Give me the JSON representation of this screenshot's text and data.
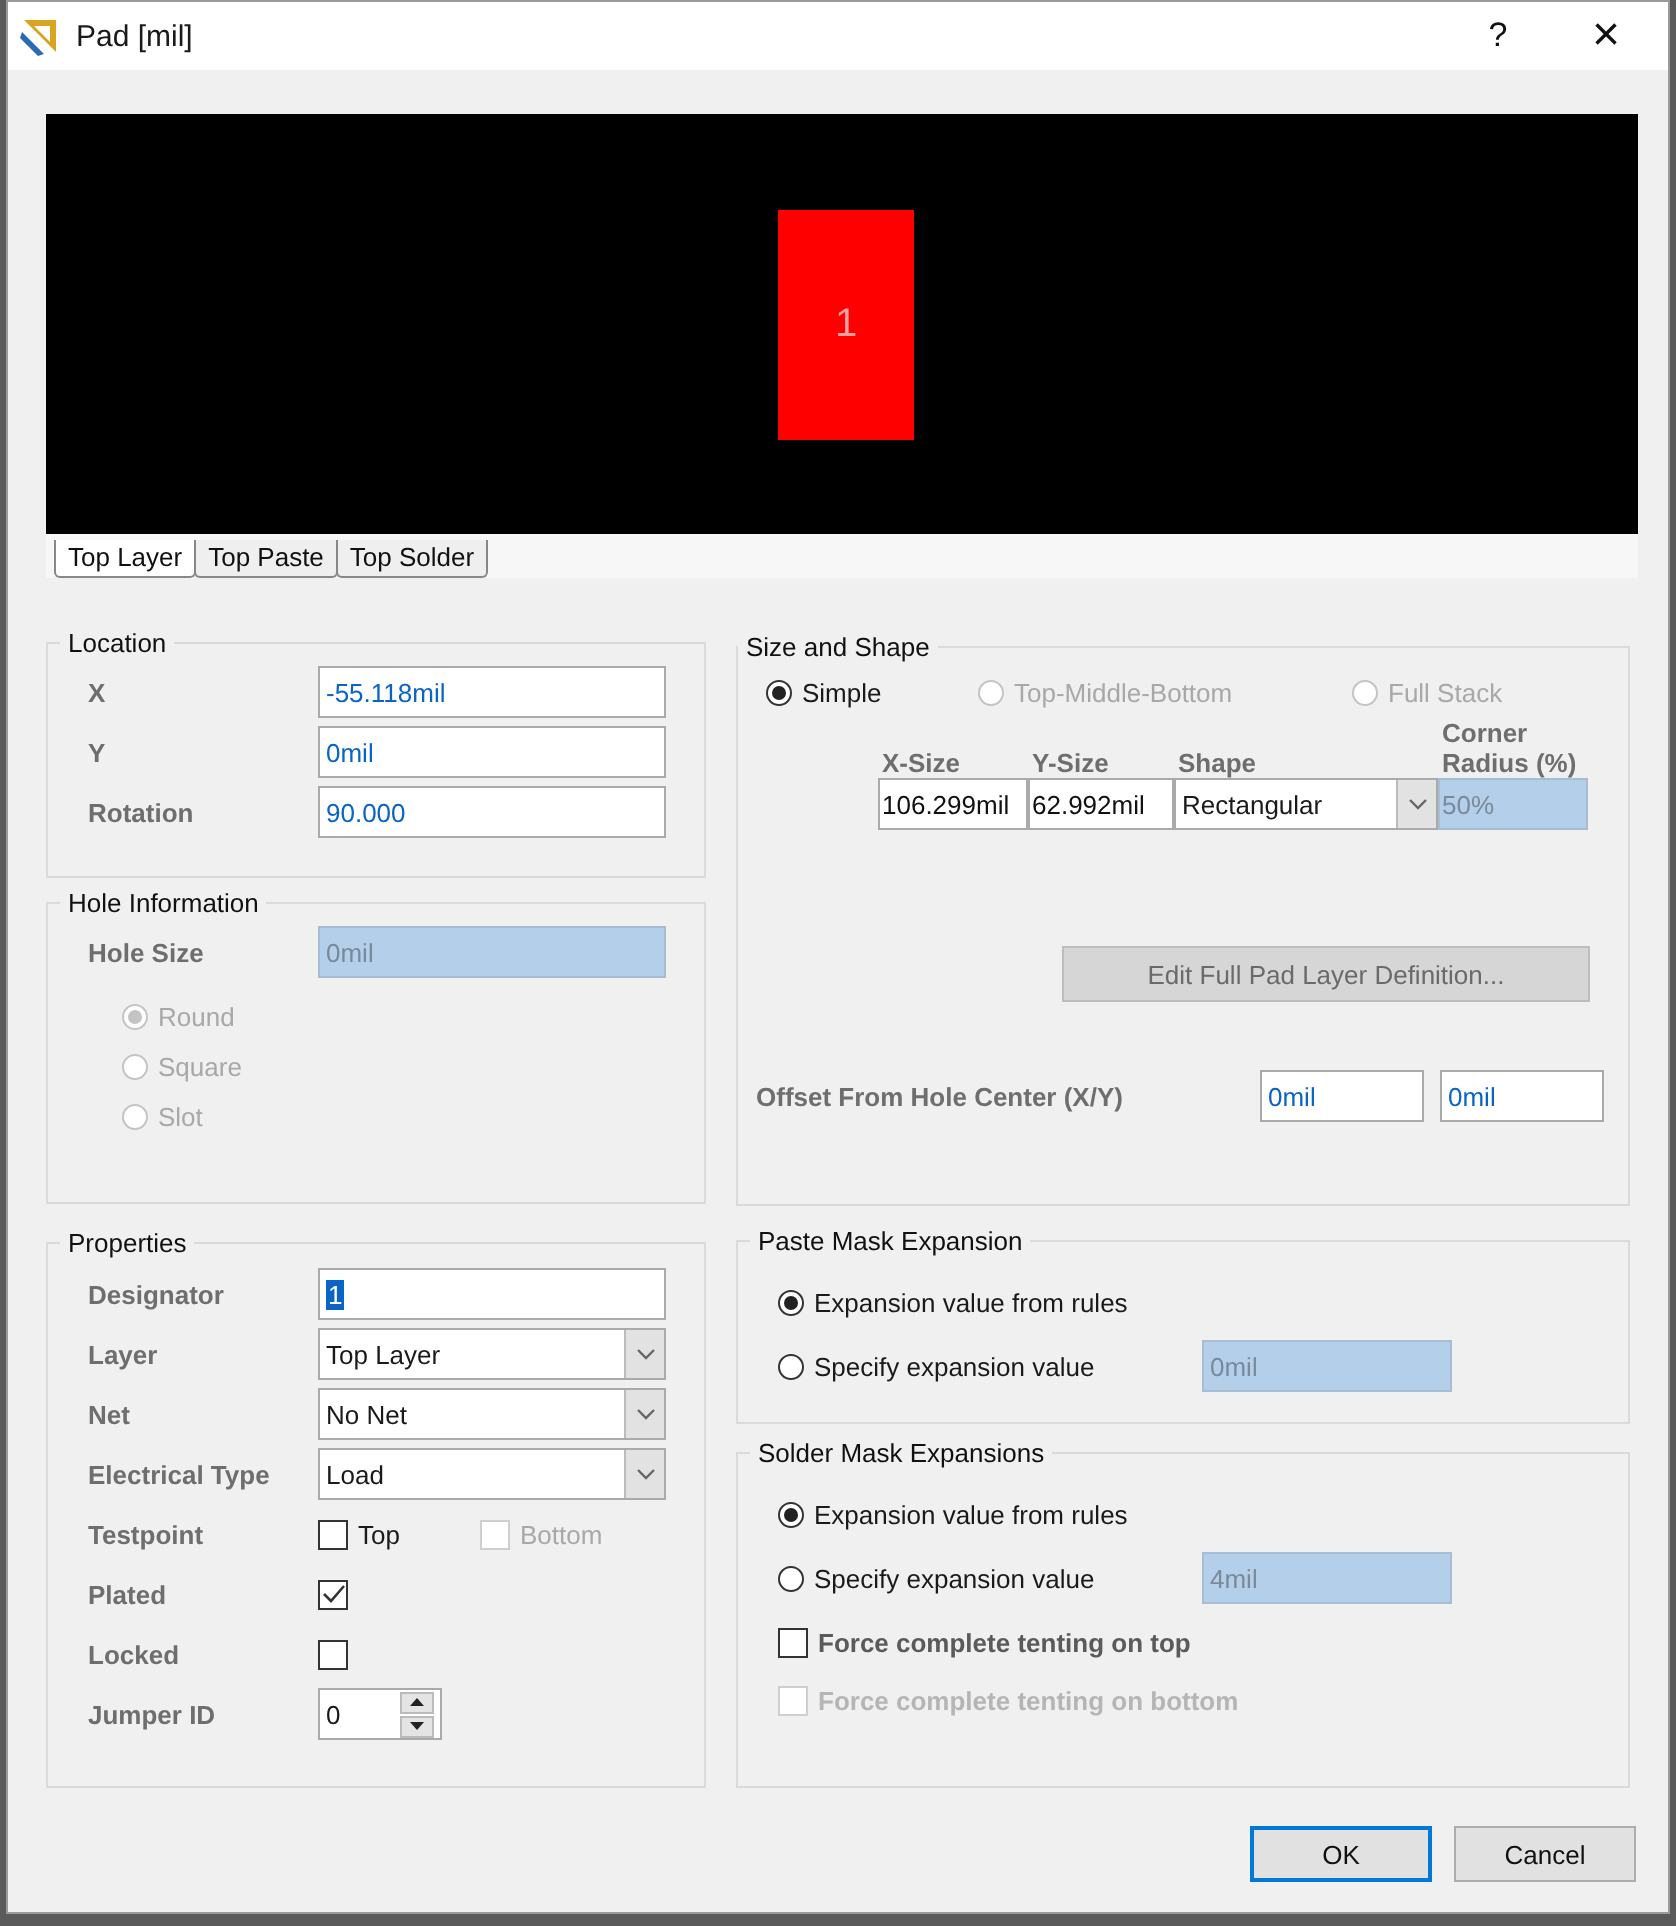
{
  "window": {
    "title": "Pad [mil]",
    "help": "?",
    "close": "×"
  },
  "preview": {
    "designator": "1"
  },
  "tabs": [
    {
      "label": "Top Layer",
      "selected": true
    },
    {
      "label": "Top Paste",
      "selected": false
    },
    {
      "label": "Top Solder",
      "selected": false
    }
  ],
  "location": {
    "title": "Location",
    "fields": [
      {
        "label": "X",
        "value": "-55.118mil",
        "disabled": false
      },
      {
        "label": "Y",
        "value": "0mil",
        "disabled": false
      },
      {
        "label": "Rotation",
        "value": "90.000",
        "disabled": false
      }
    ]
  },
  "hole_information": {
    "title": "Hole Information",
    "hole_size": {
      "label": "Hole Size",
      "value": "0mil",
      "disabled": true
    },
    "shapes": [
      {
        "label": "Round",
        "selected": true,
        "disabled": true
      },
      {
        "label": "Square",
        "selected": false,
        "disabled": true
      },
      {
        "label": "Slot",
        "selected": false,
        "disabled": true
      }
    ]
  },
  "properties": {
    "title": "Properties",
    "rows": [
      {
        "kind": "text",
        "label": "Designator",
        "value": "1"
      },
      {
        "kind": "select",
        "label": "Layer",
        "value": "Top Layer"
      },
      {
        "kind": "select",
        "label": "Net",
        "value": "No Net"
      },
      {
        "kind": "select",
        "label": "Electrical Type",
        "value": "Load"
      },
      {
        "kind": "checks",
        "label": "Testpoint",
        "checks": [
          {
            "label": "Top",
            "checked": false,
            "disabled": false
          },
          {
            "label": "Bottom",
            "checked": false,
            "disabled": true
          }
        ]
      },
      {
        "kind": "check",
        "label": "Plated",
        "checked": true
      },
      {
        "kind": "check",
        "label": "Locked",
        "checked": false
      },
      {
        "kind": "spinner",
        "label": "Jumper ID",
        "value": "0"
      }
    ]
  },
  "size_and_shape": {
    "title": "Size and Shape",
    "modes": [
      {
        "label": "Simple",
        "selected": true,
        "disabled": false
      },
      {
        "label": "Top-Middle-Bottom",
        "selected": false,
        "disabled": true
      },
      {
        "label": "Full Stack",
        "selected": false,
        "disabled": true
      }
    ],
    "columns": [
      "X-Size",
      "Y-Size",
      "Shape",
      "Corner Radius (%)"
    ],
    "row": {
      "x_size": "106.299mil",
      "y_size": "62.992mil",
      "shape": "Rectangular",
      "corner_radius": "50%"
    },
    "edit_button": {
      "label": "Edit Full Pad Layer Definition...",
      "disabled": true
    },
    "offset": {
      "label": "Offset From Hole Center (X/Y)",
      "x": "0mil",
      "y": "0mil"
    }
  },
  "paste_mask_expansion": {
    "title": "Paste Mask Expansion",
    "options": [
      {
        "label": "Expansion value from rules",
        "selected": true
      },
      {
        "label": "Specify expansion value",
        "selected": false
      }
    ],
    "value": "0mil",
    "disabled": true
  },
  "solder_mask_expansions": {
    "title": "Solder Mask Expansions",
    "options": [
      {
        "label": "Expansion value from rules",
        "selected": true
      },
      {
        "label": "Specify expansion value",
        "selected": false
      }
    ],
    "value": "4mil",
    "disabled": true,
    "tenting": [
      {
        "label": "Force complete tenting on top",
        "checked": false,
        "disabled": false
      },
      {
        "label": "Force complete tenting on bottom",
        "checked": false,
        "disabled": true
      }
    ]
  },
  "buttons": [
    {
      "label": "OK",
      "default": true
    },
    {
      "label": "Cancel",
      "default": false
    }
  ]
}
